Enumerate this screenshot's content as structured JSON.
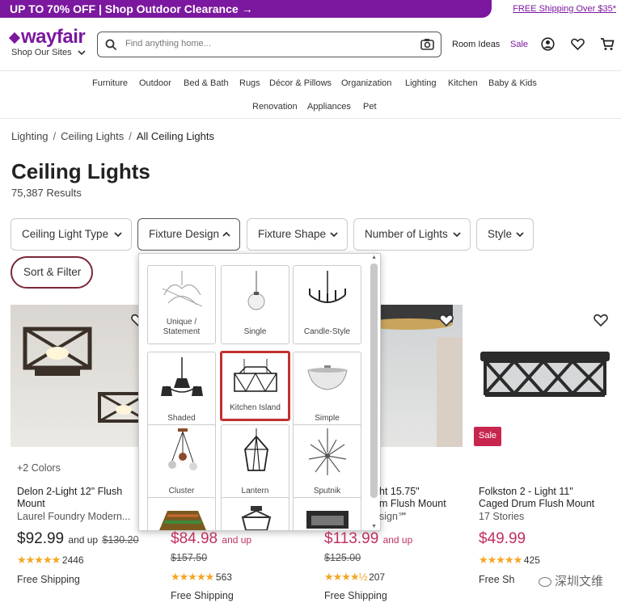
{
  "promo": {
    "text": "UP TO 70% OFF | Shop Outdoor Clearance →",
    "shipping": "FREE Shipping Over $35*"
  },
  "header": {
    "logo": "wayfair",
    "sites": "Shop Our Sites",
    "search_placeholder": "Find anything home...",
    "room_ideas": "Room Ideas",
    "sale": "Sale"
  },
  "nav": [
    "Furniture",
    "Outdoor",
    "Bed & Bath",
    "Rugs",
    "Décor & Pillows",
    "Organization",
    "Lighting",
    "Kitchen",
    "Baby & Kids",
    "Renovation",
    "Appliances",
    "Pet"
  ],
  "breadcrumb": [
    "Lighting",
    "Ceiling Lights",
    "All Ceiling Lights"
  ],
  "page": {
    "title": "Ceiling Lights",
    "results": "75,387 Results"
  },
  "filters": [
    "Ceiling Light Type",
    "Fixture Design",
    "Fixture Shape",
    "Number of Lights",
    "Style"
  ],
  "sort_filter": "Sort & Filter",
  "dropdown": {
    "tiles": [
      {
        "label": "Unique / Statement",
        "icon": "chandelier-statement-icon"
      },
      {
        "label": "Single",
        "icon": "pendant-single-icon"
      },
      {
        "label": "Candle-Style",
        "icon": "candle-chandelier-icon"
      },
      {
        "label": "Shaded",
        "icon": "shaded-chandelier-icon"
      },
      {
        "label": "Kitchen Island",
        "icon": "kitchen-island-icon",
        "selected": true
      },
      {
        "label": "Simple",
        "icon": "flush-bowl-icon"
      },
      {
        "label": "Cluster",
        "icon": "cluster-pendant-icon"
      },
      {
        "label": "Lantern",
        "icon": "lantern-icon"
      },
      {
        "label": "Sputnik",
        "icon": "sputnik-icon"
      }
    ]
  },
  "products": [
    {
      "colors": "+2 Colors",
      "name1": "Delon 2-Light 12\" Flush",
      "name2": "Mount",
      "brand": "Laurel Foundry Modern...",
      "price": "$92.99",
      "andup": "and up",
      "was": "$130.20",
      "rating_count": "2446",
      "shipping": "Free Shipping"
    },
    {
      "price": "$84.98",
      "andup": "and up",
      "was": "$157.50",
      "rating_count": "563",
      "shipping": "Free Shipping"
    },
    {
      "name1": "ht 15.75\"",
      "name2": "m Flush Mount",
      "brand": "sign℠",
      "price": "$113.99",
      "andup": "and up",
      "was": "$125.00",
      "rating_count": "207",
      "shipping": "Free Shipping"
    },
    {
      "badge": "Sale",
      "name1": "Folkston 2 - Light 11\"",
      "name2": "Caged Drum Flush Mount",
      "brand": "17 Stories",
      "price": "$49.99",
      "rating_count": "425",
      "shipping": "Free Sh"
    }
  ],
  "watermark": "深圳文维",
  "colors": {
    "brand": "#7b189f",
    "sale": "#c0305e",
    "star": "#f5a623",
    "highlight": "#c0302e"
  }
}
